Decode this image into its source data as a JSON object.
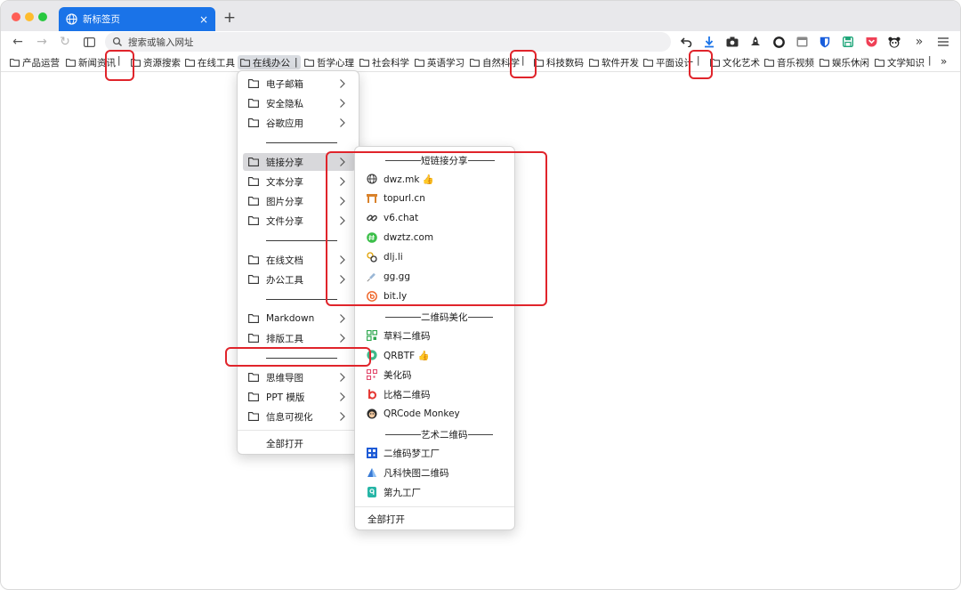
{
  "tab": {
    "title": "新标签页",
    "close": "×"
  },
  "newtab": "+",
  "toolbar": {
    "back": "←",
    "forward": "→",
    "reload": "↻",
    "search_placeholder": "搜索或输入网址",
    "icons": [
      "undo-icon",
      "download-icon",
      "camera-icon",
      "rocket-icon",
      "circle-icon",
      "cast-icon",
      "bitwarden-icon",
      "save-icon",
      "pocket-icon",
      "panda-icon",
      "more-icon",
      "menu-icon"
    ]
  },
  "bookmarks": [
    {
      "label": "产品运营"
    },
    {
      "label": "新闻资讯"
    },
    {
      "label": "资源搜索"
    },
    {
      "label": "在线工具"
    },
    {
      "label": "在线办公"
    },
    {
      "label": "哲学心理"
    },
    {
      "label": "社会科学"
    },
    {
      "label": "英语学习"
    },
    {
      "label": "自然科学"
    },
    {
      "label": "科技数码"
    },
    {
      "label": "软件开发"
    },
    {
      "label": "平面设计"
    },
    {
      "label": "文化艺术"
    },
    {
      "label": "音乐视频"
    },
    {
      "label": "娱乐休闲"
    },
    {
      "label": "文学知识"
    }
  ],
  "bookmark_separator": "|",
  "bookmark_more": "»",
  "menu1": {
    "items": [
      "电子邮箱",
      "安全隐私",
      "谷歌应用",
      "链接分享",
      "文本分享",
      "图片分享",
      "文件分享",
      "在线文档",
      "办公工具",
      "Markdown",
      "排版工具",
      "思维导图",
      "PPT 模版",
      "信息可视化"
    ],
    "open_all": "全部打开"
  },
  "menu2": {
    "section1": "短链接分享",
    "links1": [
      "dwz.mk 👍",
      "topurl.cn",
      "v6.chat",
      "dwztz.com",
      "dlj.li",
      "gg.gg",
      "bit.ly"
    ],
    "section2": "二维码美化",
    "links2": [
      "草料二维码",
      "QRBTF 👍",
      "美化码",
      "比格二维码",
      "QRCode Monkey"
    ],
    "section3": "艺术二维码",
    "links3": [
      "二维码梦工厂",
      "凡科快图二维码",
      "第九工厂"
    ],
    "open_all": "全部打开"
  },
  "colors": {
    "accent": "#1a73e8",
    "highlight_box": "#e0242b"
  }
}
